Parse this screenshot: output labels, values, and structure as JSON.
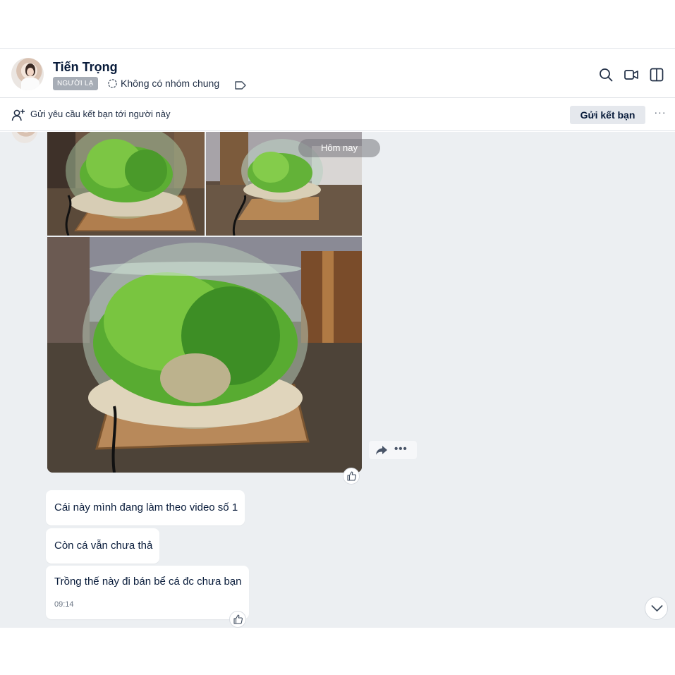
{
  "contact": {
    "name": "Tiến Trọng",
    "badge": "NGƯỜI LẠ",
    "group_info": "Không có nhóm chung"
  },
  "friend_request_bar": {
    "text": "Gửi yêu cầu kết bạn tới người này",
    "button": "Gửi kết bạn",
    "more": "···"
  },
  "chat": {
    "date_separator": "Hôm nay",
    "photos": [
      "aquarium-photo-1",
      "aquarium-photo-2",
      "aquarium-photo-3"
    ],
    "messages": [
      {
        "text": "Cái này mình đang làm theo video số 1"
      },
      {
        "text": "Còn cá vẫn chưa thả"
      },
      {
        "text": "Trồng thế này đi bán bể cá đc chưa bạn",
        "time": "09:14"
      }
    ],
    "actions_more": "•••"
  },
  "icons": {
    "search": "search-icon",
    "video_call": "video-call-icon",
    "sidebar": "sidebar-toggle-icon",
    "add_friend": "add-friend-icon",
    "share": "share-icon",
    "like": "thumbs-up-icon",
    "tag": "label-tag-icon",
    "scroll": "chevron-down-icon"
  },
  "colors": {
    "chat_background": "#eceff2",
    "badge_background": "#a7adb6",
    "text_primary": "#081b3a"
  }
}
